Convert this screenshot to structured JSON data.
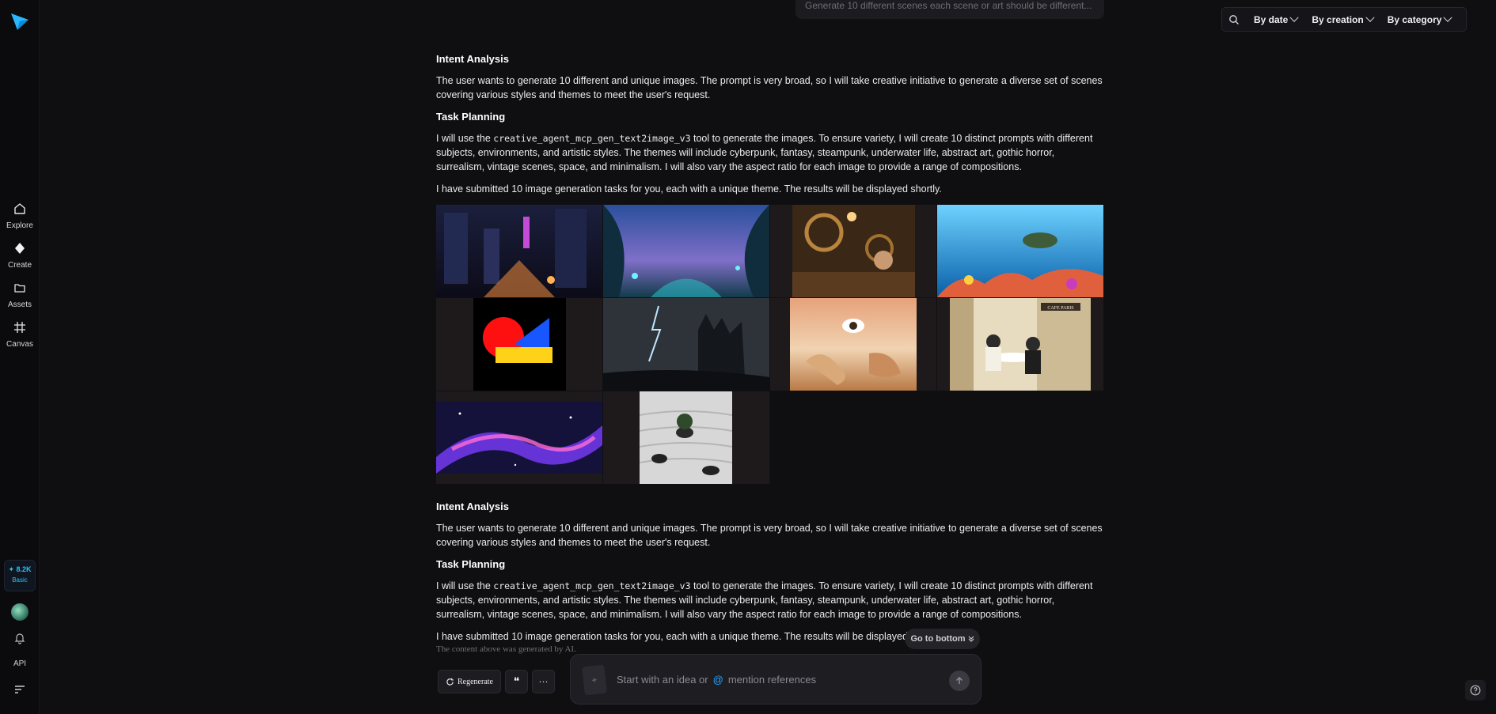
{
  "sidebar": {
    "items": [
      {
        "label": "Explore",
        "icon": "home-icon"
      },
      {
        "label": "Create",
        "icon": "diamond-icon"
      },
      {
        "label": "Assets",
        "icon": "folder-icon"
      },
      {
        "label": "Canvas",
        "icon": "frame-icon"
      }
    ],
    "credits": {
      "value": "✦ 8.2K",
      "tier": "Basic"
    },
    "api_label": "API"
  },
  "filters": {
    "by_date": "By date",
    "by_creation": "By creation",
    "by_category": "By category"
  },
  "prompt_preview": "Generate 10 different scenes each scene or art should be different...",
  "blocks": [
    {
      "intent_heading": "Intent Analysis",
      "intent_text": "The user wants to generate 10 different and unique images. The prompt is very broad, so I will take creative initiative to generate a diverse set of scenes covering various styles and themes to meet the user's request.",
      "plan_heading": "Task Planning",
      "plan_pre": "I will use the ",
      "plan_code": "creative_agent_mcp_gen_text2image_v3",
      "plan_post": " tool to generate the images. To ensure variety, I will create 10 distinct prompts with different subjects, environments, and artistic styles. The themes will include cyberpunk, fantasy, steampunk, underwater life, abstract art, gothic horror, surrealism, vintage scenes, space, and minimalism. I will also vary the aspect ratio for each image to provide a range of compositions.",
      "submitted_text": "I have submitted 10 image generation tasks for you, each with a unique theme. The results will be displayed shortly."
    },
    {
      "intent_heading": "Intent Analysis",
      "intent_text": "The user wants to generate 10 different and unique images. The prompt is very broad, so I will take creative initiative to generate a diverse set of scenes covering various styles and themes to meet the user's request.",
      "plan_heading": "Task Planning",
      "plan_pre": "I will use the ",
      "plan_code": "creative_agent_mcp_gen_text2image_v3",
      "plan_post": " tool to generate the images. To ensure variety, I will create 10 distinct prompts with different subjects, environments, and artistic styles. The themes will include cyberpunk, fantasy, steampunk, underwater life, abstract art, gothic horror, surrealism, vintage scenes, space, and minimalism. I will also vary the aspect ratio for each image to provide a range of compositions.",
      "submitted_text": "I have submitted 10 image generation tasks for you, each with a unique theme. The results will be displayed sho"
    }
  ],
  "images": [
    {
      "name": "cyberpunk-image"
    },
    {
      "name": "fantasy-forest-image"
    },
    {
      "name": "steampunk-workshop-image"
    },
    {
      "name": "underwater-reef-image"
    },
    {
      "name": "abstract-shapes-image"
    },
    {
      "name": "gothic-castle-image"
    },
    {
      "name": "surreal-desert-image"
    },
    {
      "name": "vintage-cafe-image",
      "sign": "CAFE PARIS"
    },
    {
      "name": "space-nebula-image"
    },
    {
      "name": "zen-garden-image"
    }
  ],
  "disclaimer": "The content above was generated by AI.",
  "actions": {
    "regenerate": "Regenerate",
    "quote": "❝",
    "more": "···",
    "go_to_bottom": "Go to bottom"
  },
  "input": {
    "placeholder_start": "Start with an idea or",
    "at_symbol": "@",
    "placeholder_end": "mention references"
  }
}
